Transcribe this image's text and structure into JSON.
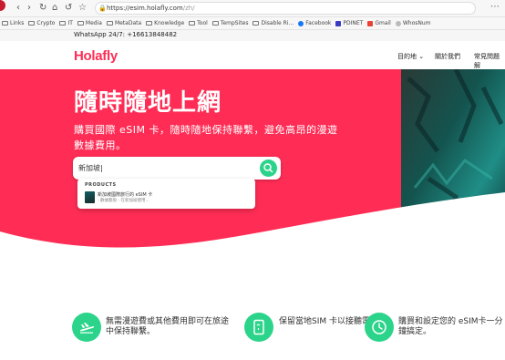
{
  "browser": {
    "url_host": "https://esim.holafly.com",
    "url_path": "/zh/",
    "bookmarks": [
      "Links",
      "Crypto",
      "IT",
      "Media",
      "MetaData",
      "Knowledge",
      "Tool",
      "TempSites",
      "Disable Ri...",
      "Facebook",
      "PDINET",
      "Gmail",
      "WhosNum"
    ]
  },
  "topbar": {
    "text": "WhatsApp 24/7: +16613848482"
  },
  "nav": {
    "logo": "Holafly",
    "links": [
      "目的地 ⌄",
      "關於我們",
      "常見問題解"
    ]
  },
  "hero": {
    "title": "隨時隨地上網",
    "subtitle": "購買國際 eSIM 卡，隨時隨地保持聯繫，避免高昂的漫遊數據費用。",
    "search_value": "新加坡|",
    "dropdown": {
      "heading": "PRODUCTS",
      "item_title": "新加坡國際旅行的 eSIM 卡",
      "item_desc": "- 數據無限 - 在新加坡使用..."
    }
  },
  "features": [
    {
      "text": "無需漫遊費或其他費用即可在旅途中保持聯繫。",
      "icon": "plane-icon"
    },
    {
      "text": "保留當地SIM 卡以接聽電話。",
      "icon": "phone-icon"
    },
    {
      "text": "購買和設定您的 eSIM卡一分鐘搞定。",
      "icon": "clock-icon"
    }
  ],
  "colors": {
    "brand": "#ff2d55",
    "accent": "#2bd48a"
  }
}
